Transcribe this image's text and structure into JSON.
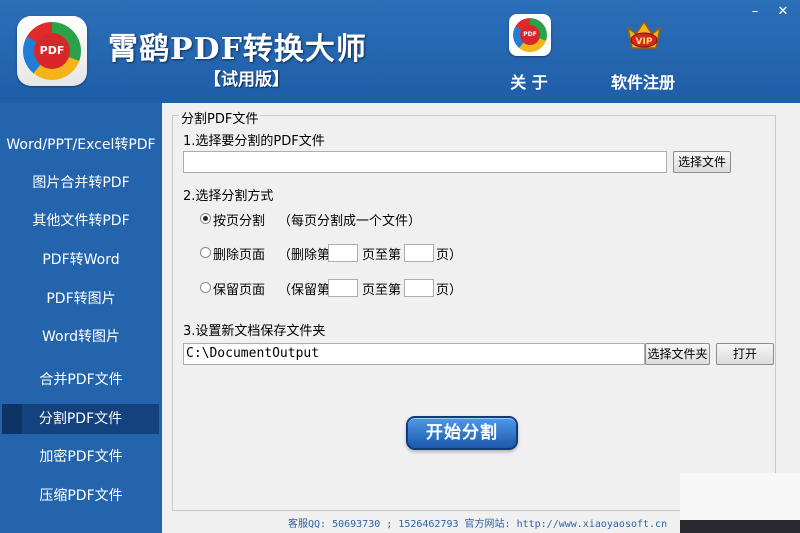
{
  "header": {
    "logo_text": "PDF",
    "title": "霄鹞PDF转换大师",
    "subtitle": "【试用版】",
    "about_label": "关 于",
    "register_label": "软件注册",
    "vip_text": "VIP",
    "minimize": "–",
    "close": "✕"
  },
  "sidebar": {
    "items": [
      {
        "label": "Word/PPT/Excel转PDF"
      },
      {
        "label": "图片合并转PDF"
      },
      {
        "label": "其他文件转PDF"
      },
      {
        "label": "PDF转Word"
      },
      {
        "label": "PDF转图片"
      },
      {
        "label": "Word转图片"
      },
      {
        "label": "合并PDF文件"
      },
      {
        "label": "分割PDF文件",
        "active": true
      },
      {
        "label": "加密PDF文件"
      },
      {
        "label": "压缩PDF文件"
      }
    ]
  },
  "main": {
    "group_title": "分割PDF文件",
    "step1_label": "1.选择要分割的PDF文件",
    "pdf_file_value": "",
    "choose_file_button": "选择文件",
    "step2_label": "2.选择分割方式",
    "option_split_label": "按页分割",
    "option_split_desc": "（每页分割成一个文件）",
    "option_split_checked": true,
    "option_delete_label": "删除页面",
    "option_delete_prefix": "（删除第",
    "option_delete_middle": "页至第",
    "option_delete_suffix": "页）",
    "option_keep_label": "保留页面",
    "option_keep_prefix": "（保留第",
    "option_keep_middle": "页至第",
    "option_keep_suffix": "页）",
    "step3_label": "3.设置新文档保存文件夹",
    "output_folder_value": "C:\\DocumentOutput",
    "choose_folder_button": "选择文件夹",
    "open_button": "打开",
    "start_button": "开始分割"
  },
  "footer": {
    "text": "客服QQ: 50693730 ; 1526462793  官方网站: http://www.xiaoyaosoft.cn"
  },
  "colors": {
    "header_bg": "#2466b0",
    "sidebar_bg": "#2464ad",
    "active_item_bg": "#14427f",
    "content_bg": "#f0f0f0",
    "start_button": "#2a6cc4",
    "footer_text": "#2b63a8"
  }
}
